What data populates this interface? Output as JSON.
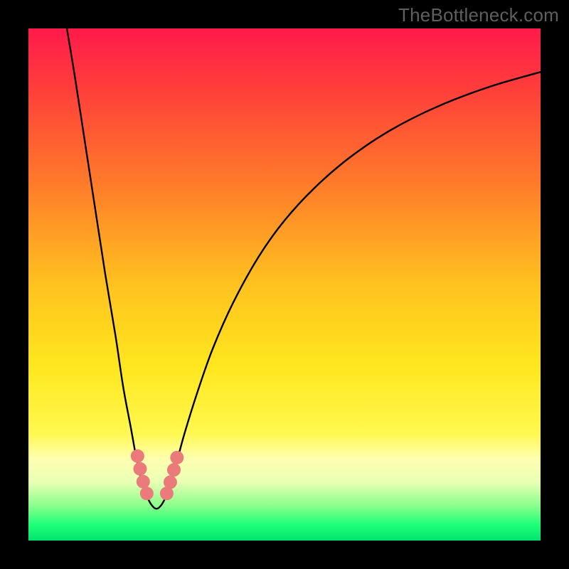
{
  "watermark": "TheBottleneck.com",
  "colors": {
    "page_bg": "#000000",
    "curve_stroke": "#000000",
    "marker_fill": "#eb7b7b",
    "marker_stroke": "#eb7b7b"
  },
  "chart_data": {
    "type": "line",
    "title": "",
    "xlabel": "",
    "ylabel": "",
    "xlim": [
      0,
      100
    ],
    "ylim": [
      0,
      100
    ],
    "grid": false,
    "gradient_stops": [
      {
        "offset": 0.0,
        "color": "#ff1a4b"
      },
      {
        "offset": 0.12,
        "color": "#ff3f3a"
      },
      {
        "offset": 0.3,
        "color": "#ff7a2a"
      },
      {
        "offset": 0.5,
        "color": "#ffc21f"
      },
      {
        "offset": 0.66,
        "color": "#ffe71e"
      },
      {
        "offset": 0.79,
        "color": "#fff84f"
      },
      {
        "offset": 0.84,
        "color": "#ffffb0"
      },
      {
        "offset": 0.885,
        "color": "#e9ffb4"
      },
      {
        "offset": 0.93,
        "color": "#8fff8d"
      },
      {
        "offset": 0.97,
        "color": "#1dff79"
      },
      {
        "offset": 1.0,
        "color": "#00e46e"
      }
    ],
    "series": [
      {
        "name": "bottleneck-curve",
        "comment": "V-shaped curve. x in 0..100 horizontal, y in 0..100 vertical (0 = top of plot). Values estimated from pixels.",
        "points": [
          {
            "x": 7.0,
            "y": -3.0
          },
          {
            "x": 9.0,
            "y": 9.0
          },
          {
            "x": 11.0,
            "y": 22.0
          },
          {
            "x": 13.0,
            "y": 35.0
          },
          {
            "x": 15.0,
            "y": 48.0
          },
          {
            "x": 17.0,
            "y": 60.0
          },
          {
            "x": 18.5,
            "y": 70.0
          },
          {
            "x": 20.0,
            "y": 78.0
          },
          {
            "x": 21.0,
            "y": 83.5
          },
          {
            "x": 22.0,
            "y": 88.0
          },
          {
            "x": 23.0,
            "y": 91.0
          },
          {
            "x": 24.0,
            "y": 93.0
          },
          {
            "x": 25.0,
            "y": 93.8
          },
          {
            "x": 26.0,
            "y": 93.0
          },
          {
            "x": 27.0,
            "y": 91.0
          },
          {
            "x": 28.0,
            "y": 88.0
          },
          {
            "x": 29.0,
            "y": 84.5
          },
          {
            "x": 30.5,
            "y": 79.0
          },
          {
            "x": 33.0,
            "y": 71.0
          },
          {
            "x": 36.0,
            "y": 62.5
          },
          {
            "x": 40.0,
            "y": 53.5
          },
          {
            "x": 45.0,
            "y": 44.5
          },
          {
            "x": 50.0,
            "y": 37.5
          },
          {
            "x": 56.0,
            "y": 31.0
          },
          {
            "x": 63.0,
            "y": 25.0
          },
          {
            "x": 71.0,
            "y": 19.7
          },
          {
            "x": 80.0,
            "y": 15.2
          },
          {
            "x": 90.0,
            "y": 11.4
          },
          {
            "x": 100.0,
            "y": 8.5
          }
        ]
      }
    ],
    "markers": {
      "name": "highlight-dots",
      "comment": "Salmon dots clustered at bottom of V. x/y in same 0..100 space.",
      "points": [
        {
          "x": 21.3,
          "y": 83.5
        },
        {
          "x": 21.8,
          "y": 86.0
        },
        {
          "x": 22.4,
          "y": 88.5
        },
        {
          "x": 23.1,
          "y": 90.8
        },
        {
          "x": 27.0,
          "y": 90.8
        },
        {
          "x": 27.7,
          "y": 88.6
        },
        {
          "x": 28.4,
          "y": 86.2
        },
        {
          "x": 29.0,
          "y": 83.8
        }
      ],
      "radius": 9
    }
  }
}
